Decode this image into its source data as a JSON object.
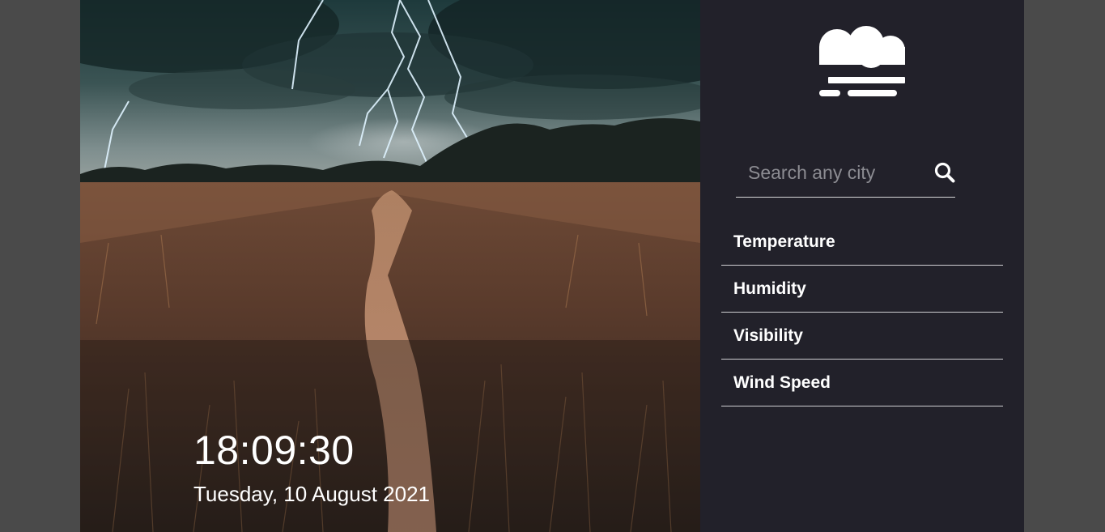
{
  "hero": {
    "time": "18:09:30",
    "date": "Tuesday,  10 August 2021"
  },
  "sidebar": {
    "weather_icon": "fog-cloud-icon",
    "search": {
      "placeholder": "Search any city",
      "value": "",
      "icon": "search-icon"
    },
    "details": [
      {
        "label": "Temperature"
      },
      {
        "label": "Humidity"
      },
      {
        "label": "Visibility"
      },
      {
        "label": "Wind Speed"
      }
    ]
  },
  "colors": {
    "page_background": "#4a4a4a",
    "sidebar_background": "#22212a",
    "text": "#ffffff",
    "divider": "#cfcfd2"
  }
}
